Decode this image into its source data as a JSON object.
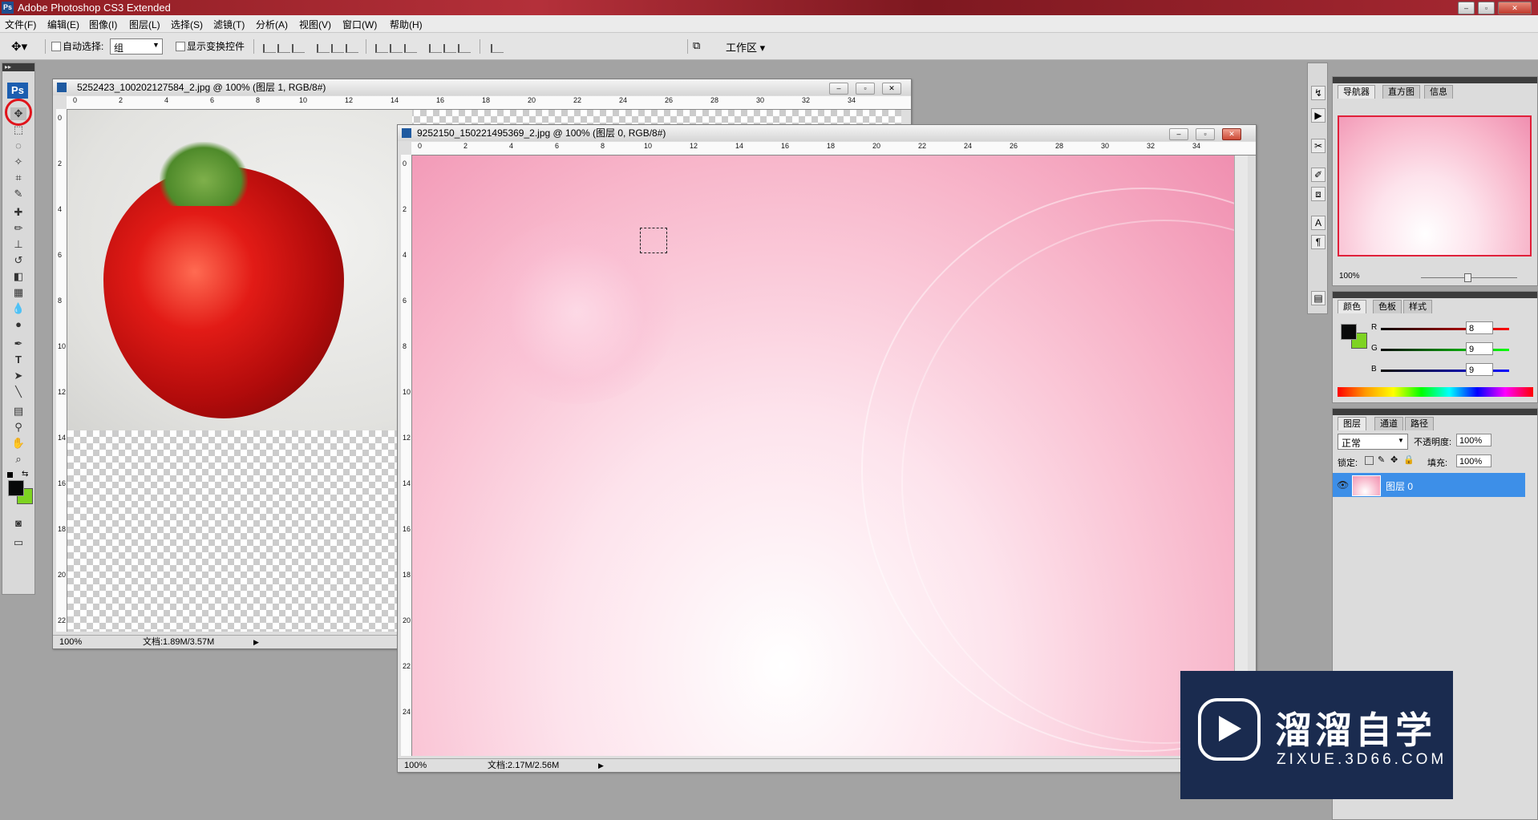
{
  "app": {
    "title": "Adobe Photoshop CS3 Extended",
    "logo": "Ps"
  },
  "window_controls": {
    "minimize": "–",
    "restore": "▫",
    "close": "✕"
  },
  "menu": [
    "文件(F)",
    "编辑(E)",
    "图像(I)",
    "图层(L)",
    "选择(S)",
    "滤镜(T)",
    "分析(A)",
    "视图(V)",
    "窗口(W)",
    "帮助(H)"
  ],
  "options": {
    "auto_select_label": "自动选择:",
    "auto_select_value": "组",
    "show_transform_label": "显示变换控件",
    "workspace_label": "工作区 ▾"
  },
  "doc1": {
    "title": "5252423_100202127584_2.jpg @ 100% (图层 1, RGB/8#)",
    "zoom": "100%",
    "docsize": "文档:1.89M/3.57M",
    "ruler_h": [
      "0",
      "2",
      "4",
      "6",
      "8",
      "10",
      "12",
      "14",
      "16",
      "18",
      "20",
      "22",
      "24",
      "26",
      "28",
      "30",
      "32",
      "34"
    ],
    "ruler_v": [
      "0",
      "2",
      "4",
      "6",
      "8",
      "10",
      "12",
      "14",
      "16",
      "18",
      "20",
      "22"
    ]
  },
  "doc2": {
    "title": "9252150_150221495369_2.jpg @ 100% (图层 0, RGB/8#)",
    "zoom": "100%",
    "docsize": "文档:2.17M/2.56M",
    "ruler_h": [
      "0",
      "2",
      "4",
      "6",
      "8",
      "10",
      "12",
      "14",
      "16",
      "18",
      "20",
      "22",
      "24",
      "26",
      "28",
      "30",
      "32",
      "34"
    ],
    "ruler_v": [
      "0",
      "2",
      "4",
      "6",
      "8",
      "10",
      "12",
      "14",
      "16",
      "18",
      "20",
      "22",
      "24"
    ]
  },
  "navigator": {
    "tabs": [
      "导航器",
      "直方图",
      "信息"
    ],
    "zoom": "100%"
  },
  "color_panel": {
    "tabs": [
      "颜色",
      "色板",
      "样式"
    ],
    "r_label": "R",
    "r": "8",
    "g_label": "G",
    "g": "9",
    "b_label": "B",
    "b": "9",
    "foreground": "#080909",
    "background": "#7ed321"
  },
  "layers_panel": {
    "tabs": [
      "图层",
      "通道",
      "路径"
    ],
    "blend_mode": "正常",
    "opacity_label": "不透明度:",
    "opacity": "100%",
    "lock_label": "锁定:",
    "fill_label": "填充:",
    "fill": "100%",
    "layer_name": "图层 0"
  },
  "watermark": {
    "brand": "溜溜自学",
    "url": "ZIXUE.3D66.COM"
  },
  "colors": {
    "selection_blue": "#3d8fe8",
    "highlight_red": "#e0141c"
  }
}
